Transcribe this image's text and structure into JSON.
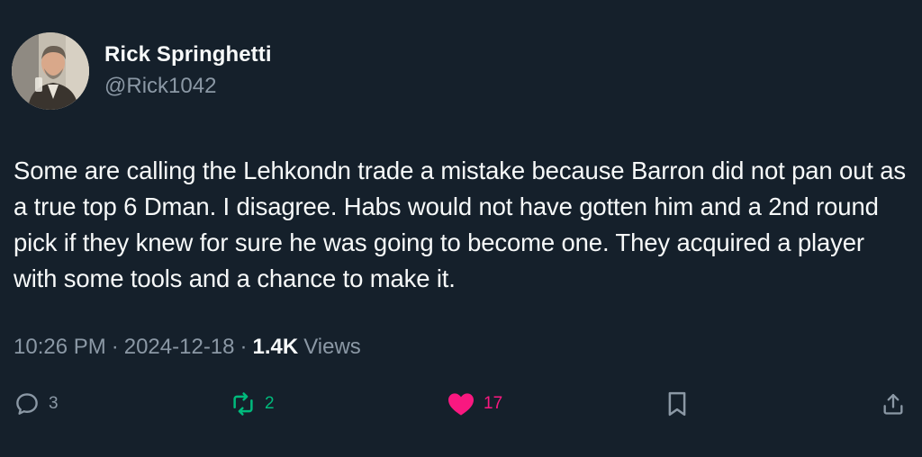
{
  "author": {
    "display_name": "Rick Springhetti",
    "handle": "@Rick1042",
    "avatar_icon": "profile-photo"
  },
  "tweet": {
    "text": "Some are calling the Lehkondn trade a mistake because Barron did not pan out as a true top 6 Dman. I disagree. Habs would not have gotten him and a 2nd round pick if they knew for sure he was going to become one. They acquired a player with some tools and a chance to make it.",
    "time": "10:26 PM",
    "separator": "·",
    "date": "2024-12-18",
    "views_count": "1.4K",
    "views_label": "Views"
  },
  "actions": {
    "reply": {
      "icon": "reply-icon",
      "count": "3"
    },
    "retweet": {
      "icon": "retweet-icon",
      "count": "2"
    },
    "like": {
      "icon": "heart-icon",
      "count": "17"
    },
    "bookmark": {
      "icon": "bookmark-icon"
    },
    "share": {
      "icon": "share-icon"
    }
  },
  "colors": {
    "background": "#15202b",
    "text_primary": "#f7f9f9",
    "text_secondary": "#8b98a5",
    "retweet_active": "#00ba7c",
    "like_active": "#f91880"
  }
}
